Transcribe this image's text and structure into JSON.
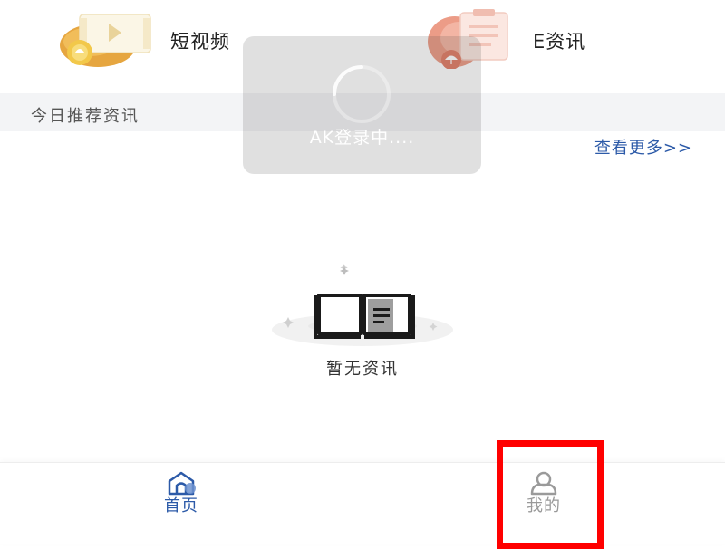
{
  "quick_entries": {
    "short_video": {
      "label": "短视频",
      "icon": "video-card-icon"
    },
    "e_news": {
      "label": "E资讯",
      "icon": "news-clipboard-icon"
    }
  },
  "section": {
    "title": "今日推荐资讯",
    "more_label": "查看更多>>"
  },
  "empty_state": {
    "message": "暂无资讯",
    "icon": "open-book-icon"
  },
  "loading": {
    "text": "AK登录中...."
  },
  "tab_bar": {
    "tabs": [
      {
        "label": "首页",
        "icon": "home-icon",
        "active": true
      },
      {
        "label": "我的",
        "icon": "user-icon",
        "active": false
      }
    ]
  },
  "colors": {
    "accent_blue": "#2c5aa8",
    "highlight_red": "#ff0000",
    "section_bg": "#f3f4f6"
  }
}
